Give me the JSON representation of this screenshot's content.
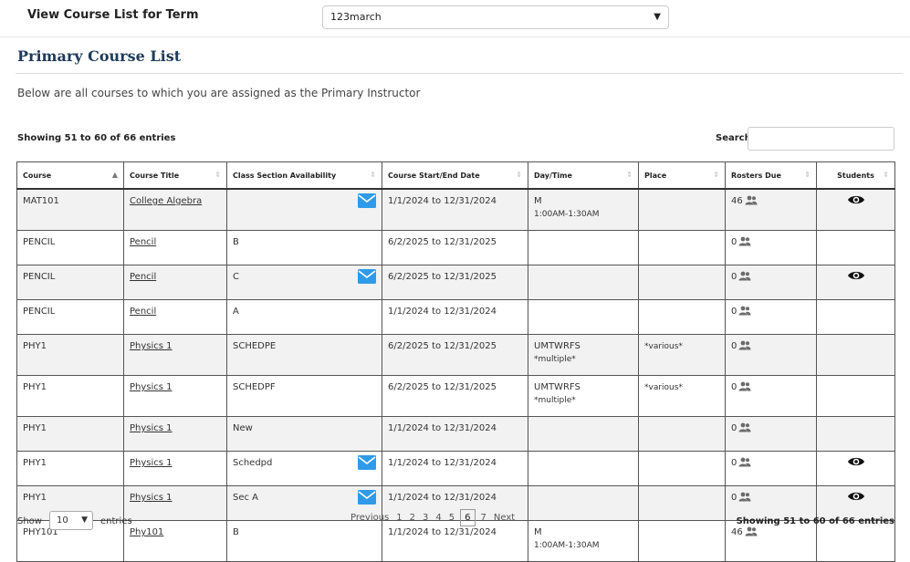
{
  "term": {
    "label": "View Course List for Term",
    "selected": "123march"
  },
  "page_title": "Primary Course List",
  "intro": "Below are all courses to which you are assigned as the Primary Instructor",
  "info_text": "Showing 51 to 60 of 66 entries",
  "search_label": "Search",
  "columns": [
    "Course",
    "Course Title",
    "Class Section Availability",
    "Course Start/End Date",
    "Day/Time",
    "Place",
    "Rosters Due",
    "Students"
  ],
  "rows": [
    {
      "course": "MAT101",
      "title": "College Algebra",
      "section": "",
      "dates": "1/1/2024 to 12/31/2024",
      "day": "M",
      "time": "1:00AM-1:30AM",
      "place": "",
      "rosters": "46"
    },
    {
      "course": "PENCIL",
      "title": "Pencil",
      "section": "B",
      "dates": "6/2/2025 to 12/31/2025",
      "day": "",
      "time": "",
      "place": "",
      "rosters": "0"
    },
    {
      "course": "PENCIL",
      "title": "Pencil",
      "section": "C",
      "dates": "6/2/2025 to 12/31/2025",
      "day": "",
      "time": "",
      "place": "",
      "rosters": "0"
    },
    {
      "course": "PENCIL",
      "title": "Pencil",
      "section": "A",
      "dates": "1/1/2024 to 12/31/2024",
      "day": "",
      "time": "",
      "place": "",
      "rosters": "0"
    },
    {
      "course": "PHY1",
      "title": "Physics 1",
      "section": "SCHEDPE",
      "dates": "6/2/2025 to 12/31/2025",
      "day": "UMTWRFS",
      "time": "*multiple*",
      "place": "*various*",
      "rosters": "0"
    },
    {
      "course": "PHY1",
      "title": "Physics 1",
      "section": "SCHEDPF",
      "dates": "6/2/2025 to 12/31/2025",
      "day": "UMTWRFS",
      "time": "*multiple*",
      "place": "*various*",
      "rosters": "0"
    },
    {
      "course": "PHY1",
      "title": "Physics 1",
      "section": "New",
      "dates": "1/1/2024 to 12/31/2024",
      "day": "",
      "time": "",
      "place": "",
      "rosters": "0"
    },
    {
      "course": "PHY1",
      "title": "Physics 1",
      "section": "Schedpd",
      "dates": "1/1/2024 to 12/31/2024",
      "day": "",
      "time": "",
      "place": "",
      "rosters": "0"
    },
    {
      "course": "PHY1",
      "title": "Physics 1",
      "section": "Sec A",
      "dates": "1/1/2024 to 12/31/2024",
      "day": "",
      "time": "",
      "place": "",
      "rosters": "0"
    },
    {
      "course": "PHY101",
      "title": "Phy101",
      "section": "B",
      "dates": "1/1/2024 to 12/31/2024",
      "day": "M",
      "time": "1:00AM-1:30AM",
      "place": "",
      "rosters": "46"
    }
  ],
  "length": {
    "show_label": "Show",
    "value": "10",
    "entries_label": "entries"
  },
  "pagination": {
    "previous": "Previous",
    "pages": [
      "1",
      "2",
      "3",
      "4",
      "5",
      "6",
      "7"
    ],
    "current": "6",
    "next": "Next"
  },
  "icons": {
    "mail": "mail-icon",
    "roster": "users-icon",
    "students": "eye-icon",
    "sort": "sort-icon"
  },
  "colors": {
    "title": "#1f3a5a",
    "mail": "#2f9be8",
    "row_alt": "#f2f2f2"
  }
}
